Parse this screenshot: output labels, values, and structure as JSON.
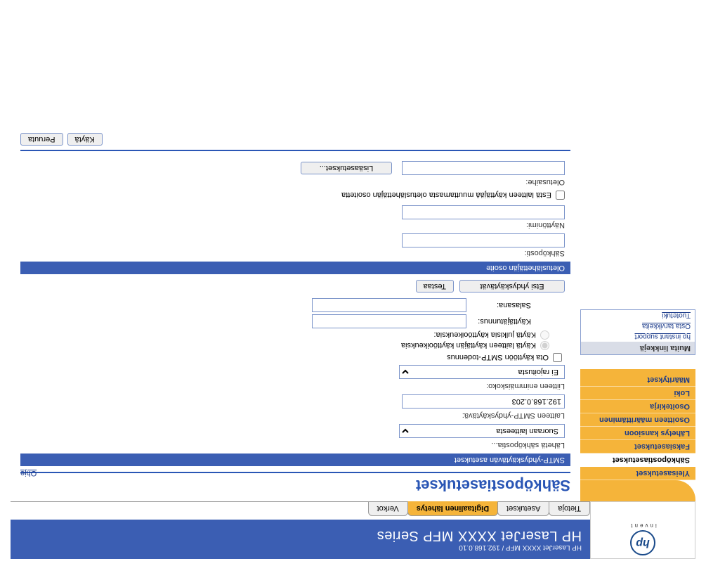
{
  "header": {
    "breadcrumb": "HP LaserJet XXXX MFP / 192.168.0.10",
    "product": "HP LaserJet XXXX MFP Series",
    "invent": "invent"
  },
  "tabs": {
    "info": "Tietoja",
    "settings": "Asetukset",
    "digital_send": "Digitaalinen lähetys",
    "network": "Verkot"
  },
  "sidebar": {
    "items": [
      "Yleisasetukset",
      "Sähköpostiasetukset",
      "Faksiasetukset",
      "Lähetys kansioon",
      "Osoitteen määrittäminen",
      "Osoitekirja",
      "Loki",
      "Määritykset"
    ]
  },
  "other_links": {
    "header": "Muita linkkejä",
    "links": [
      "hp instant support",
      "Osta tarvikkeita",
      "Tuotetuki"
    ]
  },
  "page": {
    "title": "Sähköpostiasetukset",
    "help": "Ohje"
  },
  "smtp_section": {
    "bar": "SMTP-yhdyskäytävän asetukset",
    "send_via_label": "Lähetä sähköpostia...",
    "send_via_value": "Suoraan laitteesta",
    "gateway_label": "Laitteen SMTP-yhdyskäytävä:",
    "gateway_value": "192.168.0.203",
    "max_attach_label": "Liitteen enimmäiskoko:",
    "max_attach_value": "Ei rajoitusta",
    "enable_auth": "Ota käyttöön SMTP-todennus",
    "use_device_creds": "Käytä laitteen käyttäjän käyttöoikeuksia",
    "use_public_creds": "Käytä julkisia käyttöoikeuksia:",
    "username_label": "Käyttäjätunnus:",
    "password_label": "Salasana:",
    "find_gw": "Etsi yhdyskäytävät",
    "test": "Testaa"
  },
  "from_section": {
    "bar": "Oletuslähettäjän osoite",
    "email_label": "Sähköposti:",
    "display_label": "Näyttönimi:",
    "prevent_change": "Estä laitteen käyttäjää muuttamasta oletuslähettäjän osoitetta",
    "subject_label": "Oletusaihe:",
    "advanced": "Lisäasetukset..."
  },
  "footer": {
    "apply": "Käytä",
    "cancel": "Peruuta"
  }
}
